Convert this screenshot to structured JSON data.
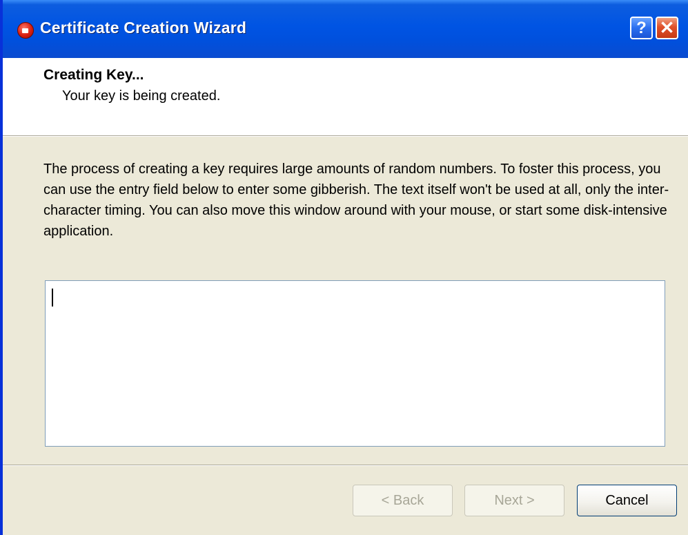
{
  "window": {
    "title": "Certificate Creation Wizard",
    "help_label": "?",
    "close_label": "✕"
  },
  "header": {
    "title": "Creating Key...",
    "subtitle": "Your key is being created."
  },
  "body": {
    "description": "The process of creating a key requires large amounts of random numbers. To foster this process, you can use the entry field below to enter some gibberish. The text itself won't be used at all, only the inter-character timing. You can also move this window around with your mouse, or start some disk-intensive application."
  },
  "entry": {
    "value": ""
  },
  "buttons": {
    "back": "< Back",
    "next": "Next >",
    "cancel": "Cancel"
  },
  "icons": {
    "app": "certificate-app-icon",
    "help": "help-icon",
    "close": "close-icon"
  },
  "colors": {
    "titlebar": "#0054e3",
    "window_bg": "#ece9d8",
    "close_button": "#e0502a"
  }
}
